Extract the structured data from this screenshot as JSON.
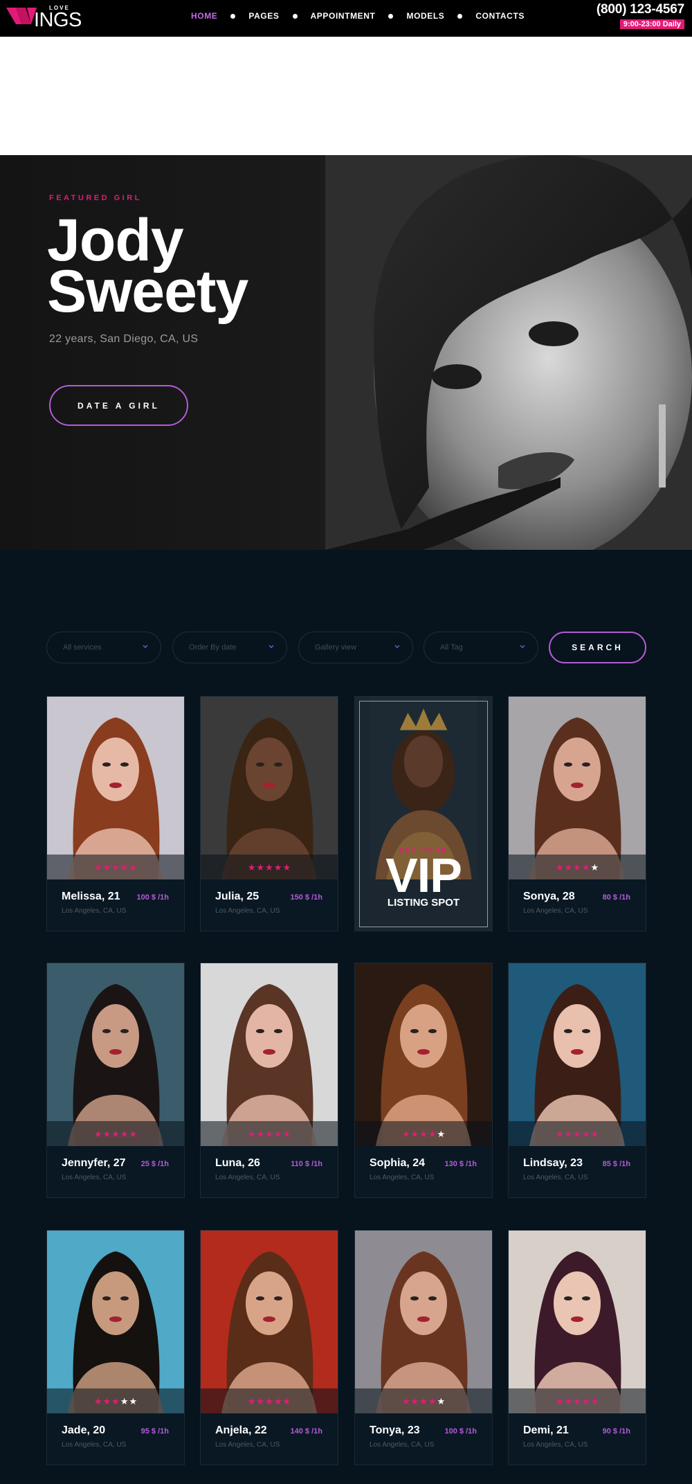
{
  "header": {
    "logo_top": "LOVE",
    "logo_main": "INGS",
    "nav": [
      {
        "label": "HOME",
        "active": true
      },
      {
        "label": "PAGES",
        "active": false
      },
      {
        "label": "APPOINTMENT",
        "active": false
      },
      {
        "label": "MODELS",
        "active": false
      },
      {
        "label": "CONTACTS",
        "active": false
      }
    ],
    "phone": "(800) 123-4567",
    "hours": "9:00-23:00 Daily"
  },
  "hero": {
    "kicker": "FEATURED GIRL",
    "name_line1": "Jody",
    "name_line2": "Sweety",
    "location": "22 years, San Diego, CA, US",
    "button": "DATE A GIRL"
  },
  "filters": {
    "services": "All services",
    "order": "Order By date",
    "view": "Gallery view",
    "tag": "All Tag",
    "search": "SEARCH"
  },
  "colors": {
    "accent_pink": "#e31b78",
    "accent_purple": "#b45bd8",
    "background": "#07131d"
  },
  "vip": {
    "kicker": "GET YOUR",
    "big": "VIP",
    "sub": "LISTING SPOT"
  },
  "models": [
    {
      "name": "Melissa, 21",
      "price": "100 $ /1h",
      "location": "Los Angeles, CA, US",
      "rating": 5
    },
    {
      "name": "Julia, 25",
      "price": "150 $ /1h",
      "location": "Los Angeles, CA, US",
      "rating": 5
    },
    {
      "vip": true
    },
    {
      "name": "Sonya, 28",
      "price": "80 $ /1h",
      "location": "Los Angeles, CA, US",
      "rating": 4
    },
    {
      "name": "Jennyfer, 27",
      "price": "25 $ /1h",
      "location": "Los Angeles, CA, US",
      "rating": 5
    },
    {
      "name": "Luna, 26",
      "price": "110 $ /1h",
      "location": "Los Angeles, CA, US",
      "rating": 5
    },
    {
      "name": "Sophia, 24",
      "price": "130 $ /1h",
      "location": "Los Angeles, CA, US",
      "rating": 4
    },
    {
      "name": "Lindsay, 23",
      "price": "85 $ /1h",
      "location": "Los Angeles, CA, US",
      "rating": 5
    },
    {
      "name": "Jade, 20",
      "price": "95 $ /1h",
      "location": "Los Angeles, CA, US",
      "rating": 3
    },
    {
      "name": "Anjela, 22",
      "price": "140 $ /1h",
      "location": "Los Angeles, CA, US",
      "rating": 5
    },
    {
      "name": "Tonya, 23",
      "price": "100 $ /1h",
      "location": "Los Angeles, CA, US",
      "rating": 4
    },
    {
      "name": "Demi, 21",
      "price": "90 $ /1h",
      "location": "Los Angeles, CA, US",
      "rating": 5
    }
  ]
}
